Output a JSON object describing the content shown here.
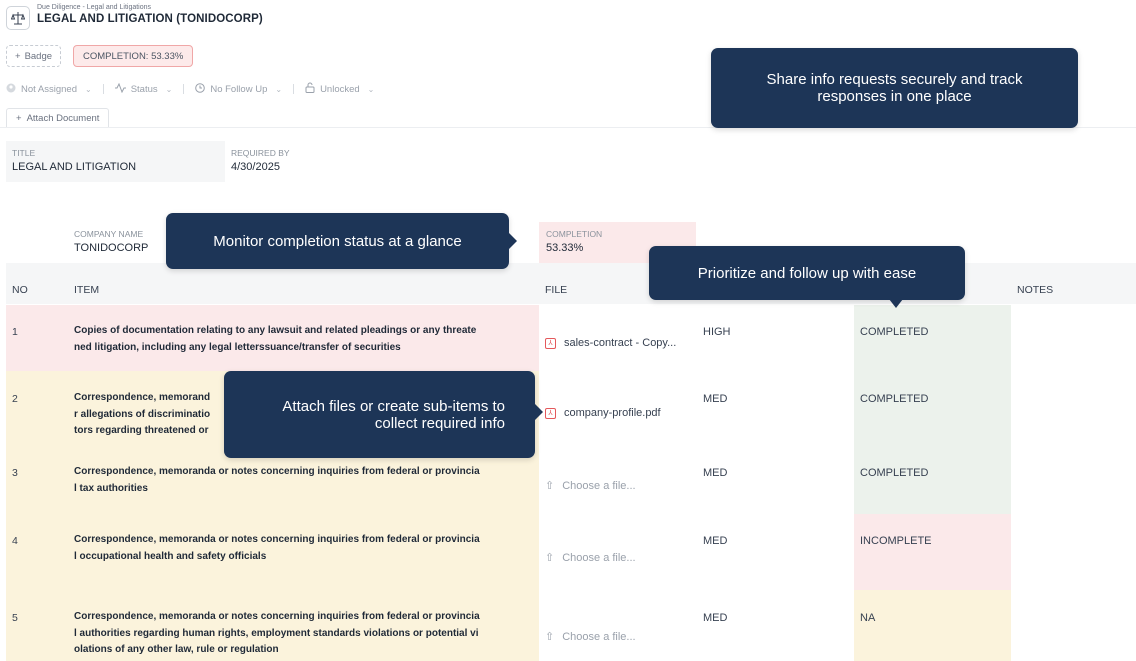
{
  "header": {
    "breadcrumb": "Due Diligence - Legal and Litigations",
    "title": "LEGAL AND LITIGATION (TONIDOCORP)",
    "icon": "scale-icon"
  },
  "toolbar": {
    "badge_label": "Badge",
    "completion_label": "COMPLETION: 53.33%",
    "assignee": "Not Assigned",
    "status": "Status",
    "follow_up": "No Follow Up",
    "lock": "Unlocked",
    "attach_label": "Attach Document"
  },
  "fields": {
    "title_label": "TITLE",
    "title_value": "LEGAL AND LITIGATION",
    "required_label": "REQUIRED BY",
    "required_value": "4/30/2025",
    "company_label": "COMPANY NAME",
    "company_value": "TONIDOCORP",
    "completion_label": "COMPLETION",
    "completion_value": "53.33%"
  },
  "table": {
    "headers": {
      "no": "NO",
      "item": "ITEM",
      "file": "FILE",
      "notes": "NOTES"
    },
    "rows": [
      {
        "no": "1",
        "item_lines": [
          "Copies of documentation relating to any lawsuit and related pleadings or any threate",
          "ned litigation, including any legal letterssuance/transfer of securities"
        ],
        "file": "sales-contract - Copy...",
        "priority": "HIGH",
        "status": "COMPLETED"
      },
      {
        "no": "2",
        "item_lines": [
          "Correspondence, memorand",
          "r allegations of discriminatio",
          "tors regarding threatened or"
        ],
        "file": "company-profile.pdf",
        "priority": "MED",
        "status": "COMPLETED"
      },
      {
        "no": "3",
        "item_lines": [
          "Correspondence, memoranda or notes concerning inquiries from federal or provincia",
          "l tax authorities"
        ],
        "file": "Choose a file...",
        "priority": "MED",
        "status": "COMPLETED"
      },
      {
        "no": "4",
        "item_lines": [
          "Correspondence, memoranda or notes concerning inquiries from federal or provincia",
          "l occupational health and safety officials"
        ],
        "file": "Choose a file...",
        "priority": "MED",
        "status": "INCOMPLETE"
      },
      {
        "no": "5",
        "item_lines": [
          "Correspondence, memoranda or notes concerning inquiries from federal or provincia",
          "l authorities regarding human rights, employment standards violations or potential vi",
          "olations of any other law, rule or regulation"
        ],
        "file": "Choose a file...",
        "priority": "MED",
        "status": "NA"
      }
    ]
  },
  "callouts": {
    "share": [
      "Share info requests securely and track",
      "responses in one place"
    ],
    "monitor": "Monitor completion status at a glance",
    "prioritize": "Prioritize and follow up with ease",
    "attach": [
      "Attach files or create sub-items to",
      "collect required info"
    ]
  },
  "colors": {
    "callout_bg": "#1d3557",
    "row_red": "#fbe9ea",
    "row_yellow": "#fbf3dc",
    "status_green": "#ecf2ec"
  }
}
